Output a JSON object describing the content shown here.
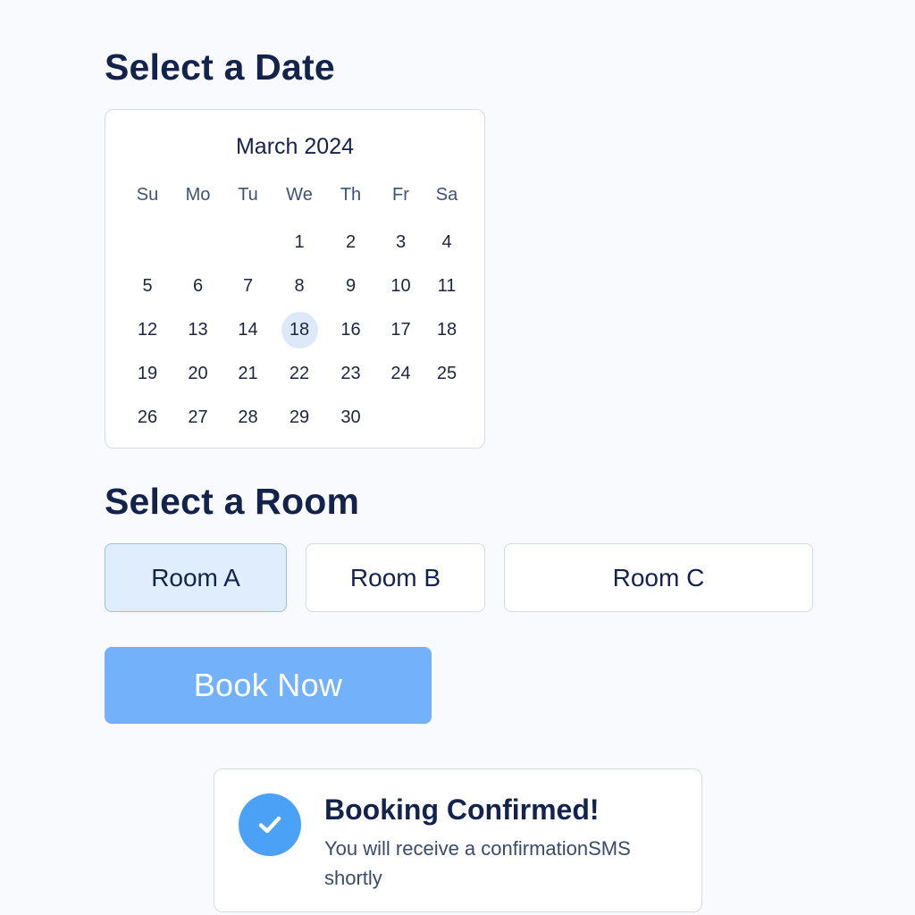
{
  "date_section": {
    "title": "Select a Date"
  },
  "calendar": {
    "month_label": "March 2024",
    "weekdays": [
      "Su",
      "Mo",
      "Tu",
      "We",
      "Th",
      "Fr",
      "Sa"
    ],
    "leading_blanks": 3,
    "days": [
      "1",
      "2",
      "3",
      "4",
      "5",
      "6",
      "7",
      "8",
      "9",
      "10",
      "11",
      "12",
      "13",
      "14",
      "18",
      "16",
      "17",
      "18",
      "19",
      "20",
      "21",
      "22",
      "23",
      "24",
      "25",
      "26",
      "27",
      "28",
      "29",
      "30"
    ],
    "selected_index": 14
  },
  "room_section": {
    "title": "Select a Room",
    "rooms": [
      {
        "label": "Room A",
        "selected": true
      },
      {
        "label": "Room B",
        "selected": false
      },
      {
        "label": "Room C",
        "selected": false
      }
    ]
  },
  "book_button": {
    "label": "Book Now"
  },
  "toast": {
    "icon": "checkmark-icon",
    "title": "Booking Confirmed!",
    "message": "You will receive a confirmationSMS shortly"
  },
  "colors": {
    "accent": "#4aa1f5",
    "book_button": "#74b1fb",
    "selected_bg": "#dfedfd",
    "text_dark": "#14234b"
  }
}
